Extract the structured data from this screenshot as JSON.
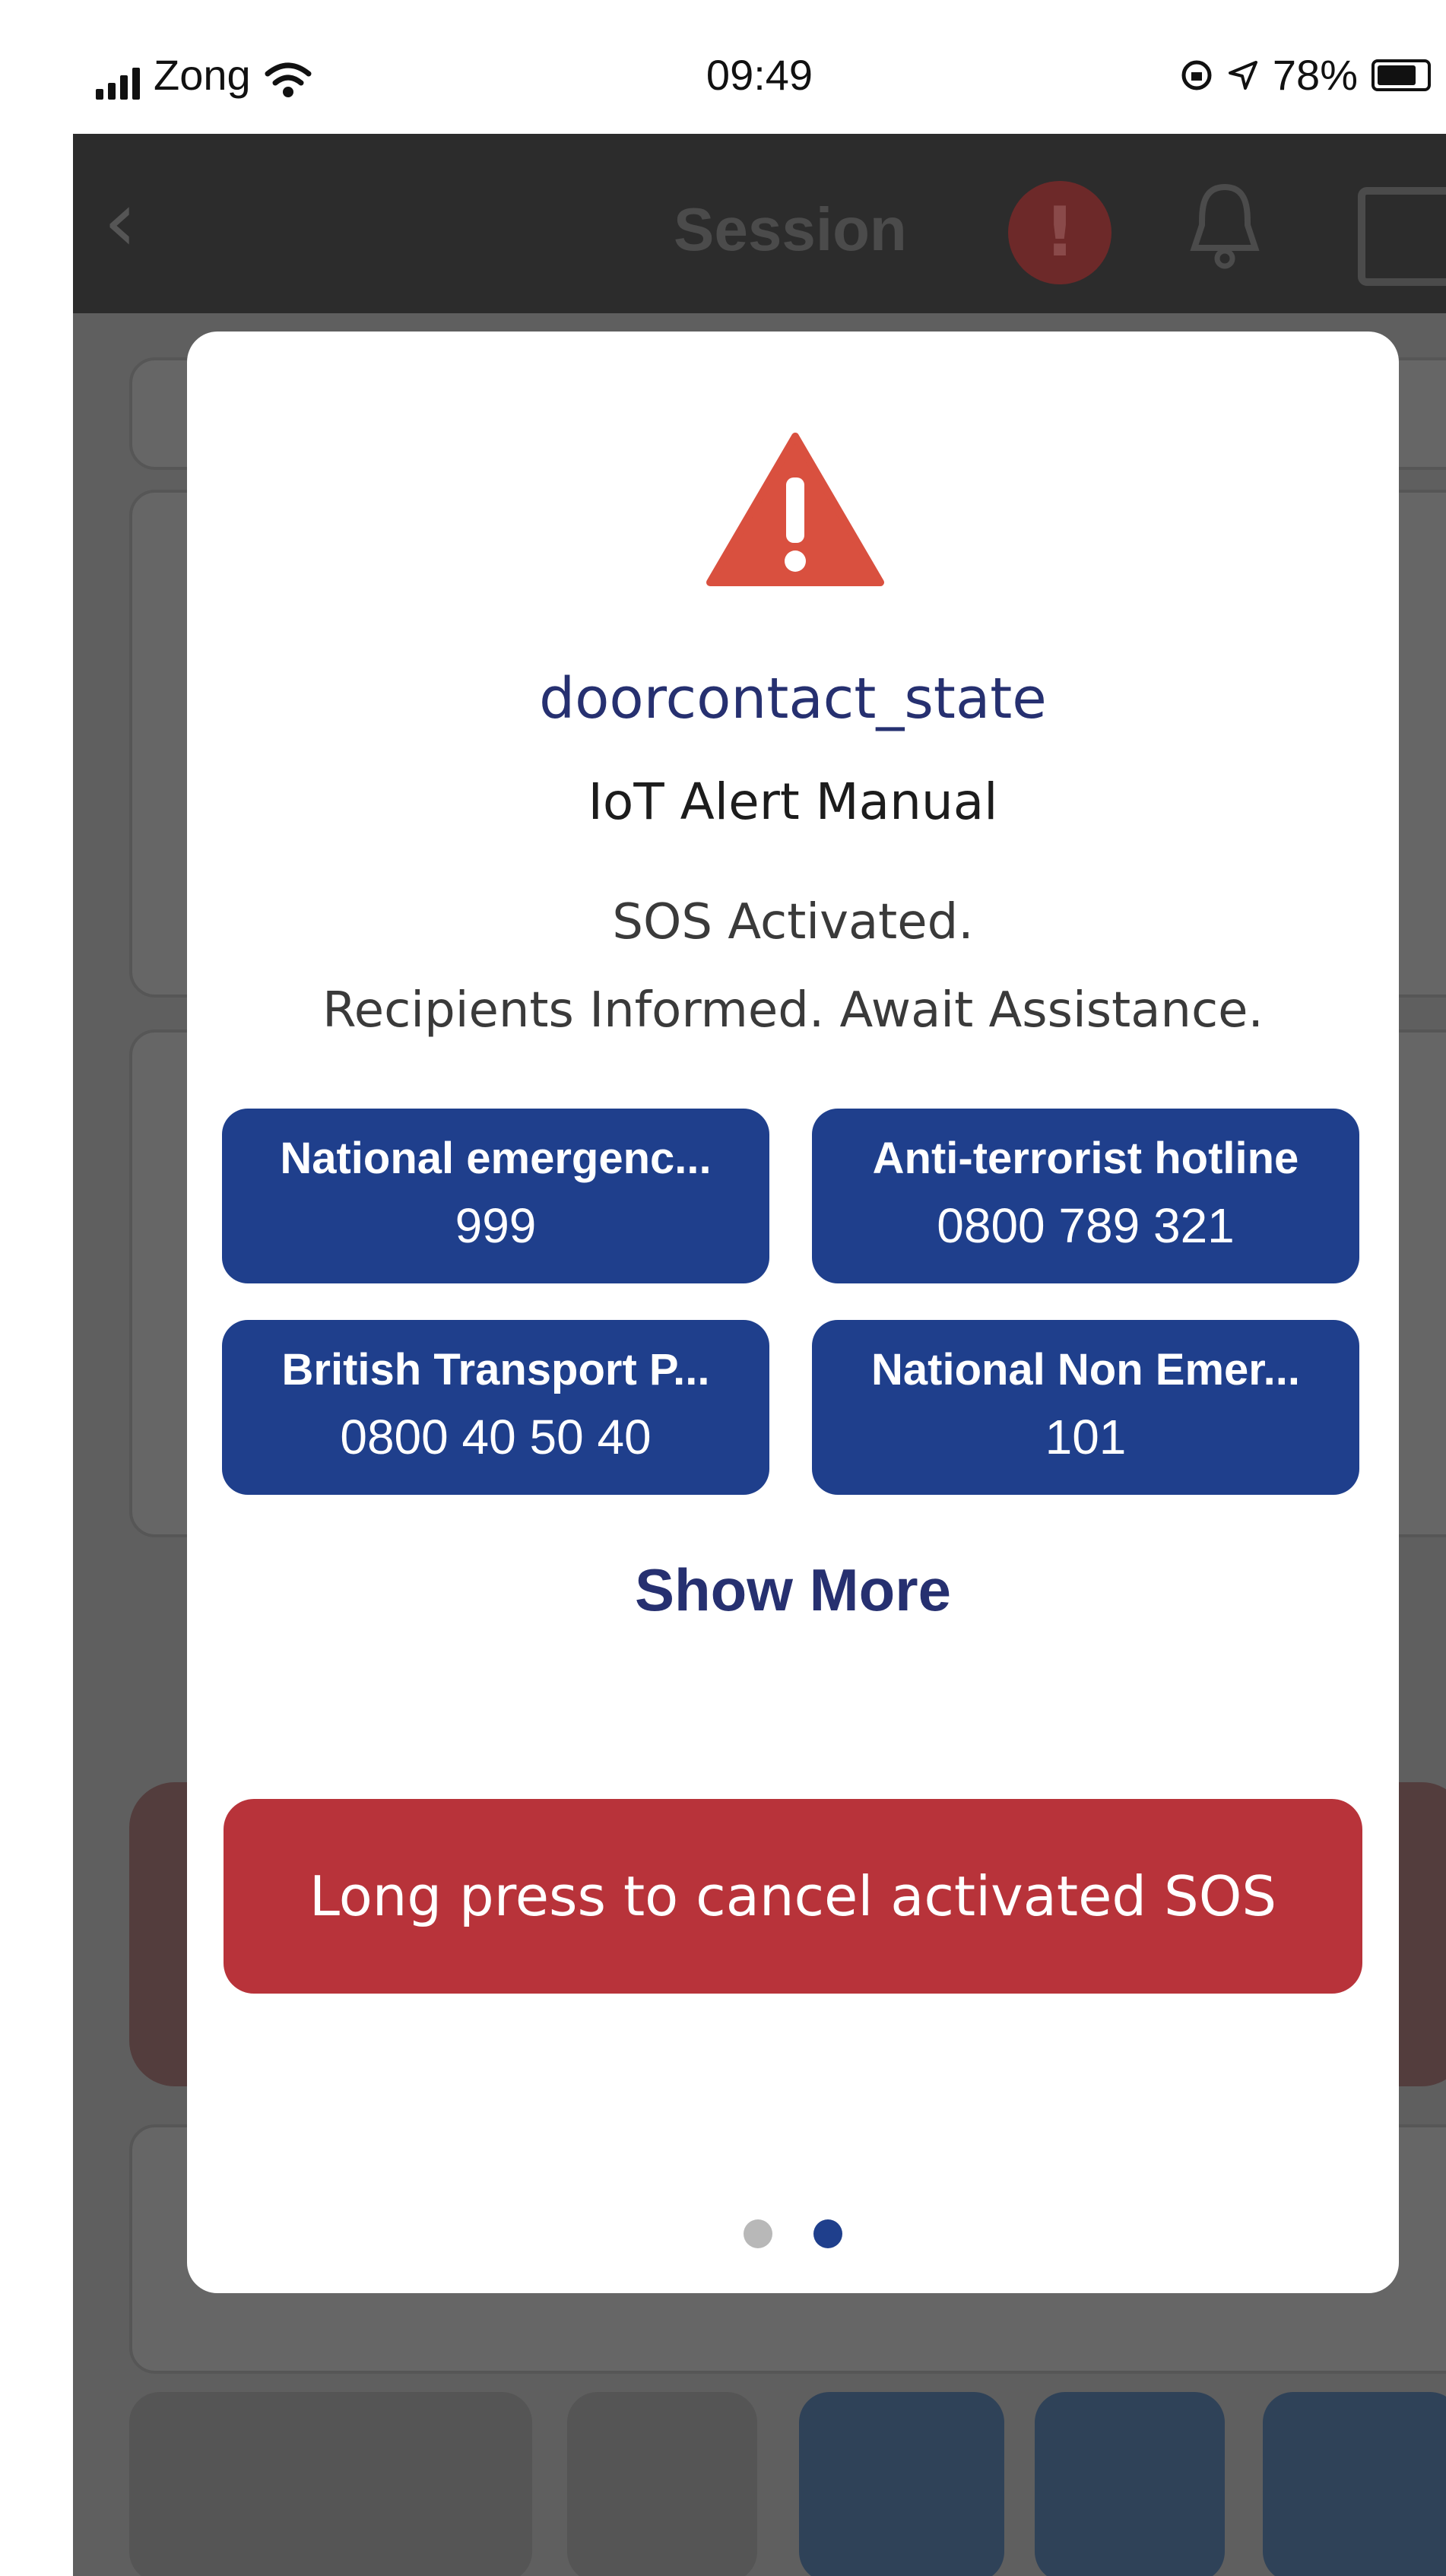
{
  "status_bar": {
    "carrier": "Zong",
    "time": "09:49",
    "battery": "78%",
    "icons": [
      "signal-icon",
      "wifi-icon",
      "orientation-lock-icon",
      "location-icon",
      "battery-icon"
    ]
  },
  "nav": {
    "title": "Session",
    "alert_badge": "!",
    "icons": [
      "back-icon",
      "alert-icon",
      "bell-icon",
      "calendar-icon"
    ]
  },
  "modal": {
    "icon": "warning-triangle-icon",
    "title": "doorcontact_state",
    "subtitle": "IoT Alert Manual",
    "message_line1": "SOS Activated.",
    "message_line2": "Recipients Informed. Await Assistance.",
    "contacts": [
      {
        "name": "National emergenc...",
        "number": "999"
      },
      {
        "name": "Anti-terrorist hotline",
        "number": "0800 789 321"
      },
      {
        "name": "British Transport P...",
        "number": "0800 40 50 40"
      },
      {
        "name": "National Non Emer...",
        "number": "101"
      }
    ],
    "show_more": "Show More",
    "cancel_button": "Long press to cancel activated SOS",
    "pagination": {
      "total": 2,
      "active": 2
    }
  },
  "colors": {
    "accent_blue": "#1f3f8c",
    "title_navy": "#263070",
    "warning_red": "#d9503f",
    "cancel_red": "#b8333a"
  }
}
